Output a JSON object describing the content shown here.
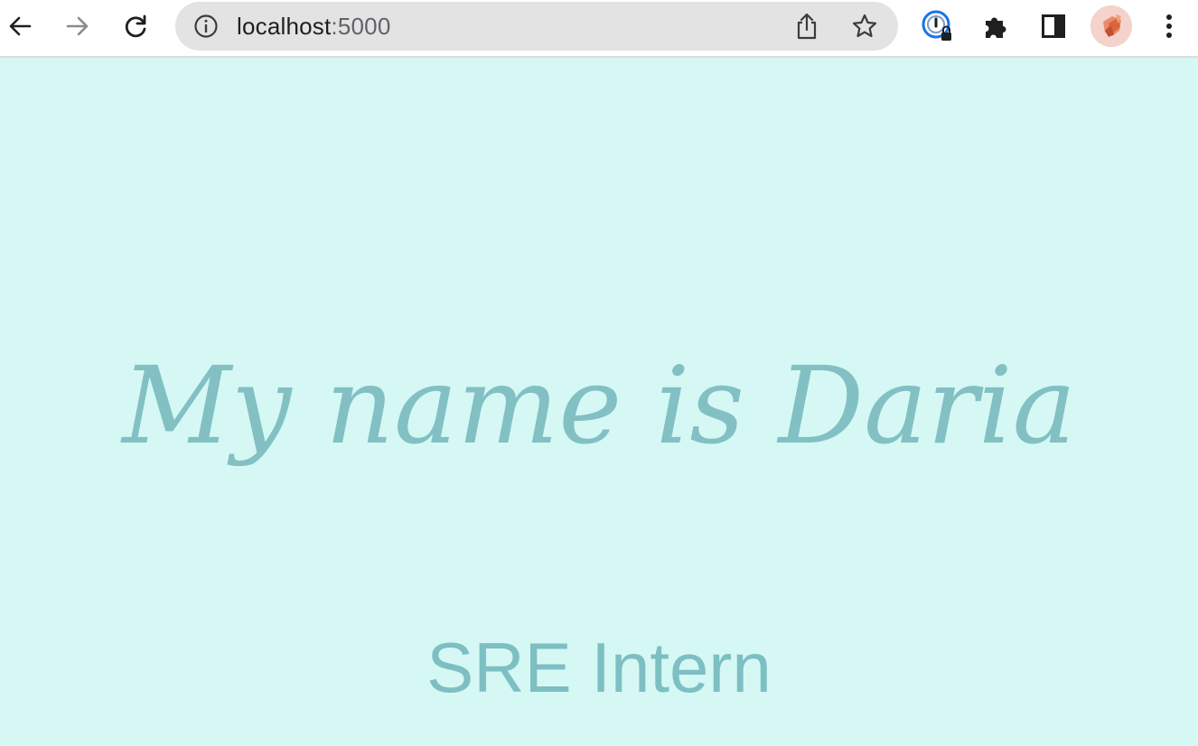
{
  "browser": {
    "url_host": "localhost",
    "url_port": ":5000",
    "icons": {
      "back": "back-arrow-icon",
      "forward": "forward-arrow-icon",
      "reload": "reload-icon",
      "site_info": "info-icon",
      "share": "share-icon",
      "bookmark": "star-icon",
      "password_manager": "password-manager-icon",
      "extensions": "puzzle-piece-icon",
      "side_panel": "side-panel-icon",
      "menu": "kebab-menu-icon"
    }
  },
  "page": {
    "heading": "My name is Daria",
    "subtitle": "SRE Intern"
  },
  "colors": {
    "background": "#d5f8f4",
    "heading": "#82c0c3",
    "subtitle": "#7dbfc2"
  }
}
